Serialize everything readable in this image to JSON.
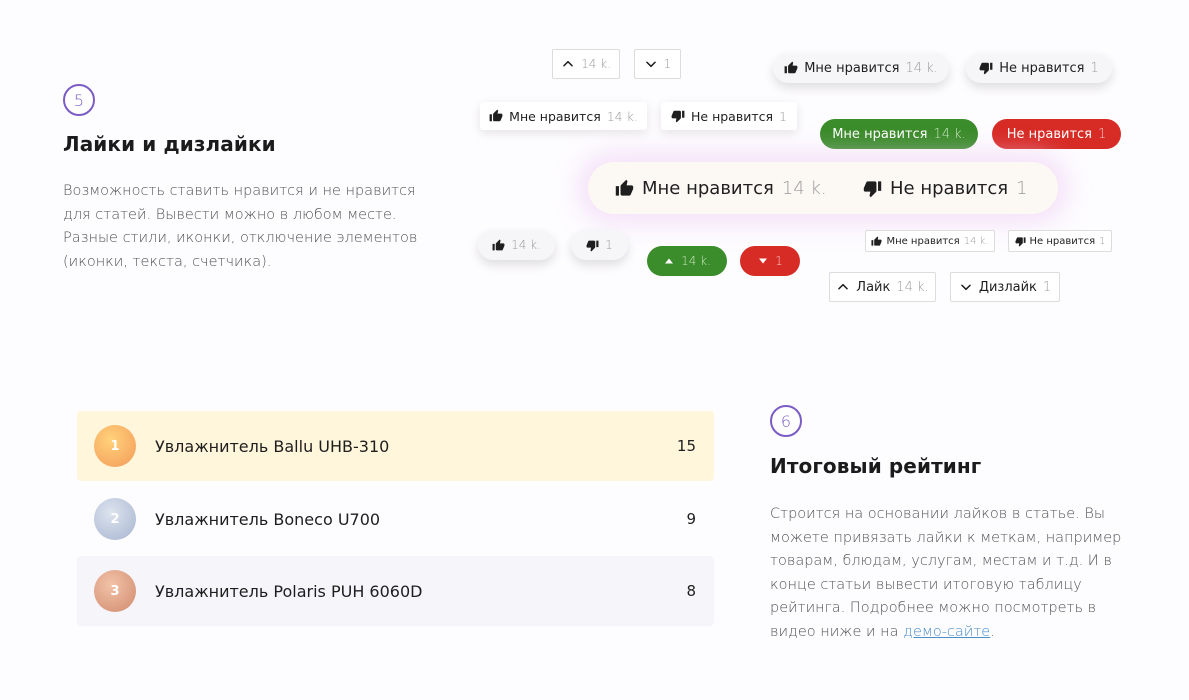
{
  "section5": {
    "number": "5",
    "title": "Лайки и дизлайки",
    "desc_lines": [
      "Возможность ставить нравится и не нравится",
      "для статей. Вывести можно в любом месте.",
      "Разные стили, иконки, отключение элементов",
      "(иконки, текста, счетчика)."
    ]
  },
  "buttons": {
    "like_count": "14 k.",
    "dislike_count": "1",
    "like_label": "Мне нравится",
    "dislike_label": "Не нравится",
    "like_short": "Лайк",
    "dislike_short": "Дизлайк"
  },
  "section6": {
    "number": "6",
    "title": "Итоговый рейтинг",
    "desc_lines": [
      "Строится на основании лайков в статье. Вы",
      "можете привязать лайки к меткам, например",
      "товарам, блюдам, услугам, местам и т.д. И в",
      "конце статьи вывести итоговую таблицу",
      "рейтинга. Подробнее можно посмотреть в"
    ],
    "desc_last_prefix": "видео ниже и на ",
    "demo_link": "демо-сайте",
    "desc_last_suffix": "."
  },
  "rating": [
    {
      "rank": "1",
      "name": "Увлажнитель Ballu UHB-310",
      "score": "15"
    },
    {
      "rank": "2",
      "name": "Увлажнитель Boneco U700",
      "score": "9"
    },
    {
      "rank": "3",
      "name": "Увлажнитель Polaris PUH 6060D",
      "score": "8"
    }
  ],
  "colors": {
    "accent": "#7b5cc4",
    "like_green": "#3b8c2a",
    "dislike_red": "#d72b25",
    "gold_row": "#fff6dc",
    "link": "#4a8ecb"
  },
  "icons": [
    "thumb-up-icon",
    "thumb-down-icon",
    "chevron-up-icon",
    "chevron-down-icon",
    "triangle-up-icon",
    "triangle-down-icon"
  ]
}
